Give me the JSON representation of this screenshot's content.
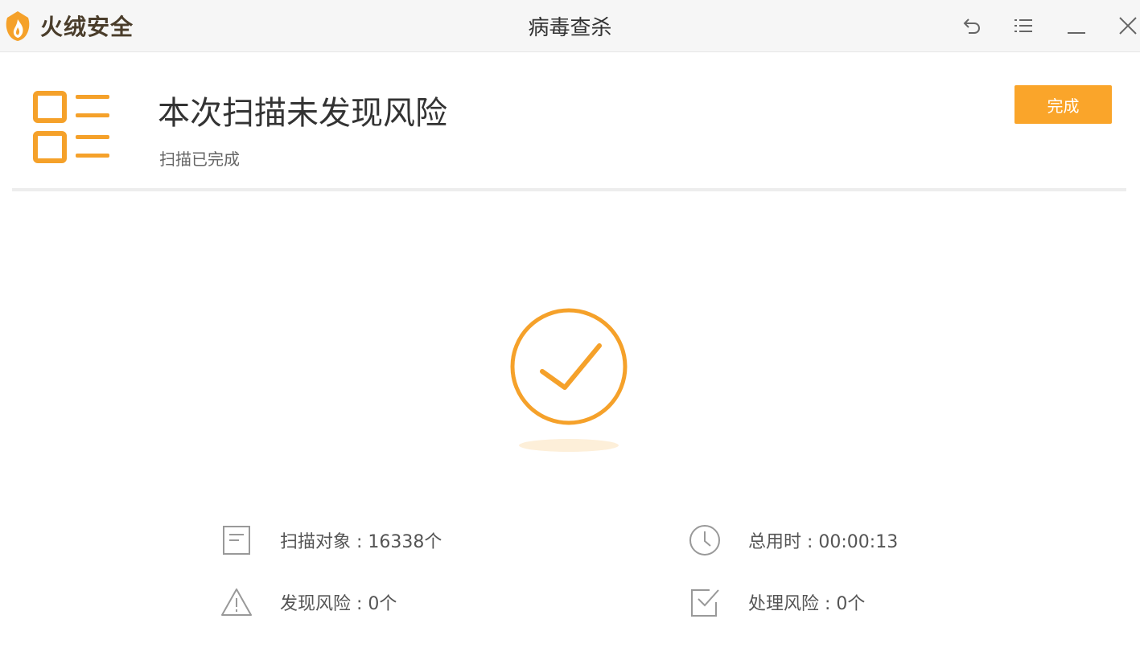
{
  "app": {
    "brand_name": "火绒安全",
    "window_title": "病毒查杀",
    "accent_color": "#faa52a"
  },
  "window_controls": {
    "back_icon": "back-arrow-icon",
    "menu_icon": "menu-list-icon",
    "minimize_icon": "minimize-icon",
    "close_icon": "close-icon"
  },
  "result": {
    "title": "本次扫描未发现风险",
    "subtitle": "扫描已完成",
    "done_button_label": "完成",
    "status_icon": "checkmark-circle-icon"
  },
  "stats": {
    "scanned": {
      "label": "扫描对象 : 16338个",
      "icon": "document-icon"
    },
    "found": {
      "label": "发现风险 : 0个",
      "icon": "warning-icon"
    },
    "time": {
      "label": "总用时 : 00:00:13",
      "icon": "clock-icon"
    },
    "handled": {
      "label": "处理风险 : 0个",
      "icon": "checkbox-icon"
    }
  }
}
